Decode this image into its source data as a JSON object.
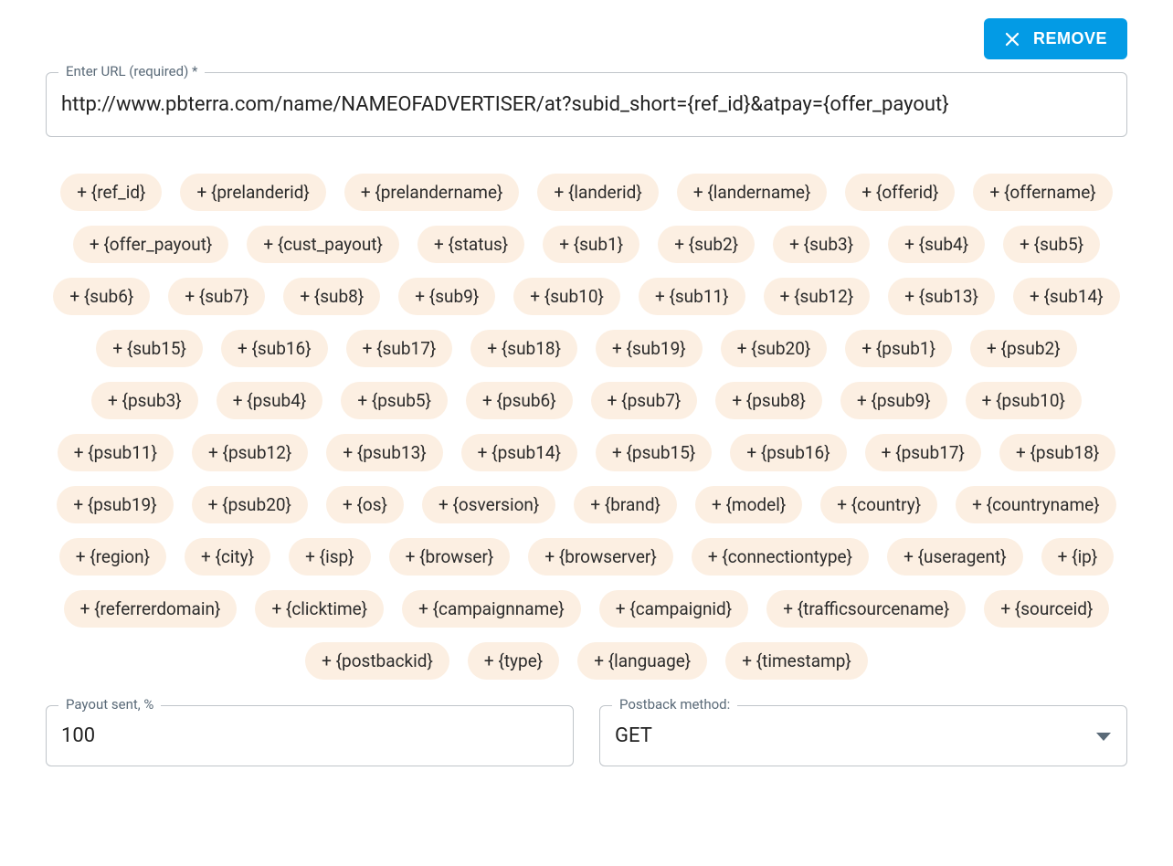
{
  "remove_button_label": "REMOVE",
  "url_field": {
    "label": "Enter URL (required) *",
    "value": "http://www.pbterra.com/name/NAMEOFADVERTISER/at?subid_short={ref_id}&atpay={offer_payout}"
  },
  "tokens": [
    "{ref_id}",
    "{prelanderid}",
    "{prelandername}",
    "{landerid}",
    "{landername}",
    "{offerid}",
    "{offername}",
    "{offer_payout}",
    "{cust_payout}",
    "{status}",
    "{sub1}",
    "{sub2}",
    "{sub3}",
    "{sub4}",
    "{sub5}",
    "{sub6}",
    "{sub7}",
    "{sub8}",
    "{sub9}",
    "{sub10}",
    "{sub11}",
    "{sub12}",
    "{sub13}",
    "{sub14}",
    "{sub15}",
    "{sub16}",
    "{sub17}",
    "{sub18}",
    "{sub19}",
    "{sub20}",
    "{psub1}",
    "{psub2}",
    "{psub3}",
    "{psub4}",
    "{psub5}",
    "{psub6}",
    "{psub7}",
    "{psub8}",
    "{psub9}",
    "{psub10}",
    "{psub11}",
    "{psub12}",
    "{psub13}",
    "{psub14}",
    "{psub15}",
    "{psub16}",
    "{psub17}",
    "{psub18}",
    "{psub19}",
    "{psub20}",
    "{os}",
    "{osversion}",
    "{brand}",
    "{model}",
    "{country}",
    "{countryname}",
    "{region}",
    "{city}",
    "{isp}",
    "{browser}",
    "{browserver}",
    "{connectiontype}",
    "{useragent}",
    "{ip}",
    "{referrerdomain}",
    "{clicktime}",
    "{campaignname}",
    "{campaignid}",
    "{trafficsourcename}",
    "{sourceid}",
    "{postbackid}",
    "{type}",
    "{language}",
    "{timestamp}"
  ],
  "payout_field": {
    "label": "Payout sent, %",
    "value": "100"
  },
  "method_field": {
    "label": "Postback method:",
    "value": "GET"
  }
}
